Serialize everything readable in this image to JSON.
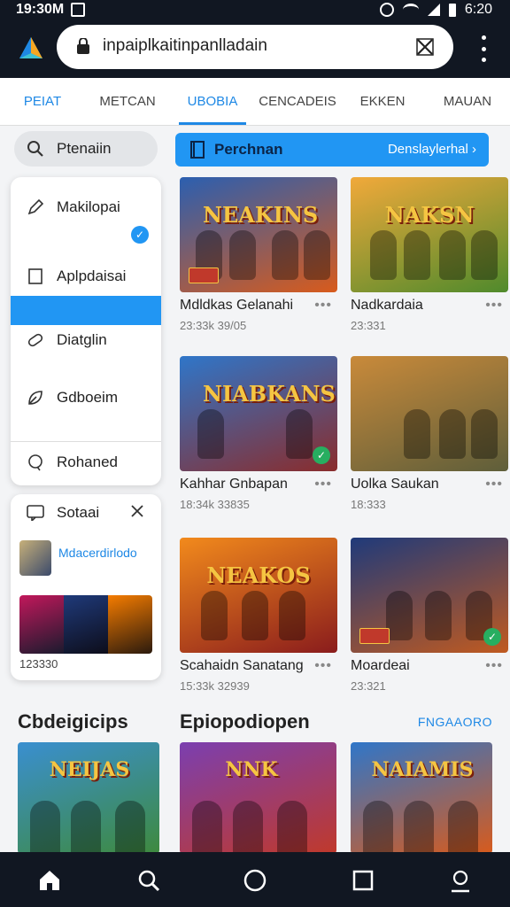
{
  "status_bar": {
    "time": "19:30M",
    "clock_right": "6:20"
  },
  "url_bar": {
    "url": "inpaiplkaitinpanlladain",
    "icons": [
      "app-logo",
      "lock-icon",
      "close-icon",
      "more-icon"
    ]
  },
  "tabs": [
    {
      "label": "PEIAT",
      "style": "blue"
    },
    {
      "label": "METCAN"
    },
    {
      "label": "UBOBIA",
      "style": "blue",
      "active": true
    },
    {
      "label": "CENCADEIS"
    },
    {
      "label": "EKKEN"
    },
    {
      "label": "MAUAN"
    }
  ],
  "sidebar": {
    "search_label": "Ptenaiin",
    "menu_items": [
      {
        "label": "Makilopai",
        "icon": "pencil-icon"
      },
      {
        "label": "Aplpdaisai",
        "icon": "page-icon"
      },
      {
        "label": "Diatglin",
        "icon": "pill-icon"
      },
      {
        "label": "Gdboeim",
        "icon": "leaf-icon"
      },
      {
        "label": "Rohaned",
        "icon": "chat-icon"
      }
    ],
    "badge": "✓",
    "suggest": {
      "title": "Sotaai",
      "link_text": "Mdacerdirlodo",
      "number": "123330"
    }
  },
  "banner": {
    "label": "Perchnan",
    "action": "Denslaylerhal ›"
  },
  "games": [
    {
      "title": "Mdldkas Gelanahi",
      "meta": "23:33k 39/05",
      "logo": "NEAKINS",
      "colors": [
        "#2b5fb0",
        "#d85b1c"
      ],
      "tag": true,
      "check": false
    },
    {
      "title": "Nadkardaia",
      "meta": "23:331",
      "logo": "NAKSN",
      "colors": [
        "#f1a93a",
        "#4f8a2c"
      ],
      "tag": false,
      "check": false
    },
    {
      "title": "Kahhar Gnbapan",
      "meta": "18:34k 33835",
      "logo": "NIABKANS",
      "colors": [
        "#2f76c9",
        "#8a2c2c"
      ],
      "tag": false,
      "check": true
    },
    {
      "title": "Uolka Saukan",
      "meta": "18:333",
      "logo": "",
      "colors": [
        "#c98a3a",
        "#5e5e3a"
      ],
      "tag": false,
      "check": false
    },
    {
      "title": "Scahaidn Sanatang",
      "meta": "15:33k 32939",
      "logo": "NEAKOS",
      "colors": [
        "#f28a1c",
        "#8a1c1c"
      ],
      "tag": false,
      "check": false
    },
    {
      "title": "Moardeai",
      "meta": "23:321",
      "logo": "",
      "colors": [
        "#1f3a7a",
        "#c05a20"
      ],
      "tag": true,
      "check": true
    }
  ],
  "sections": {
    "left": "Cbdeigicips",
    "center": "Epiopodiopen",
    "right_link": "FNGAAORO"
  },
  "bottom_row": [
    {
      "logo": "NEIJAS",
      "colors": [
        "#3a8fd0",
        "#3e8a3e"
      ]
    },
    {
      "logo": "NNK",
      "colors": [
        "#7b3fb0",
        "#c0392b"
      ]
    },
    {
      "logo": "NAIAMIS",
      "colors": [
        "#2f76c9",
        "#d85b1c"
      ]
    }
  ],
  "nav_icons": [
    "home-icon",
    "search-icon",
    "circle-home-icon",
    "recents-icon",
    "profile-icon"
  ]
}
